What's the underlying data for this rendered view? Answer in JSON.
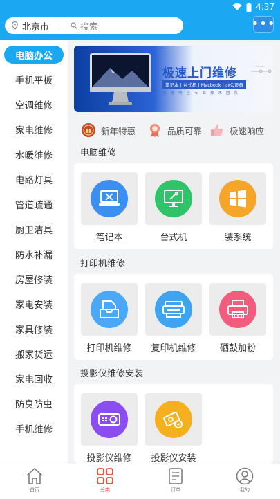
{
  "status_bar": {
    "time": "4:37"
  },
  "header": {
    "city": "北京市",
    "search_placeholder": "搜索",
    "more_label": "•••"
  },
  "sidebar": {
    "items": [
      {
        "label": "电脑办公",
        "active": true
      },
      {
        "label": "手机平板"
      },
      {
        "label": "空调维修"
      },
      {
        "label": "家电维修"
      },
      {
        "label": "水暖维修"
      },
      {
        "label": "电路灯具"
      },
      {
        "label": "管道疏通"
      },
      {
        "label": "厨卫洁具"
      },
      {
        "label": "防水补漏"
      },
      {
        "label": "房屋修装"
      },
      {
        "label": "家电安装"
      },
      {
        "label": "家具修装"
      },
      {
        "label": "搬家货运"
      },
      {
        "label": "家电回收"
      },
      {
        "label": "防臭防虫"
      },
      {
        "label": "手机维修"
      }
    ]
  },
  "banner": {
    "title": "极速上门维修",
    "tags": "笔记本 | 台式机 | Macbook | 办公设备",
    "small_text": "极速响应专业技术团队"
  },
  "features": [
    {
      "label": "新年特惠",
      "icon": "gift-badge-icon"
    },
    {
      "label": "品质可靠",
      "icon": "quality-ribbon-icon"
    },
    {
      "label": "极速响应",
      "icon": "thumbs-up-icon"
    }
  ],
  "sections": [
    {
      "title": "电脑维修",
      "items": [
        {
          "label": "笔记本",
          "icon": "laptop-tools-icon",
          "color": "#3b8ff3"
        },
        {
          "label": "台式机",
          "icon": "monitor-wrench-icon",
          "color": "#2fc468"
        },
        {
          "label": "装系统",
          "icon": "windows-logo-icon",
          "color": "#f5a62a"
        }
      ]
    },
    {
      "title": "打印机维修",
      "items": [
        {
          "label": "打印机维修",
          "icon": "printer-tray-icon",
          "color": "#4aa8f7"
        },
        {
          "label": "复印机维修",
          "icon": "copier-icon",
          "color": "#3fa3f0"
        },
        {
          "label": "硒鼓加粉",
          "icon": "cartridge-icon",
          "color": "#f25d7e"
        }
      ]
    },
    {
      "title": "投影仪维修安装",
      "items": [
        {
          "label": "投影仪维修",
          "icon": "projector-icon",
          "color": "#8b4cf0"
        },
        {
          "label": "投影仪安装",
          "icon": "projector-gear-icon",
          "color": "#f5b020"
        }
      ]
    }
  ],
  "tabbar": {
    "tabs": [
      {
        "label": "首页",
        "icon": "home-icon"
      },
      {
        "label": "分类",
        "icon": "category-grid-icon",
        "active": true
      },
      {
        "label": "订单",
        "icon": "order-doc-icon"
      },
      {
        "label": "我的",
        "icon": "user-profile-icon"
      }
    ]
  }
}
